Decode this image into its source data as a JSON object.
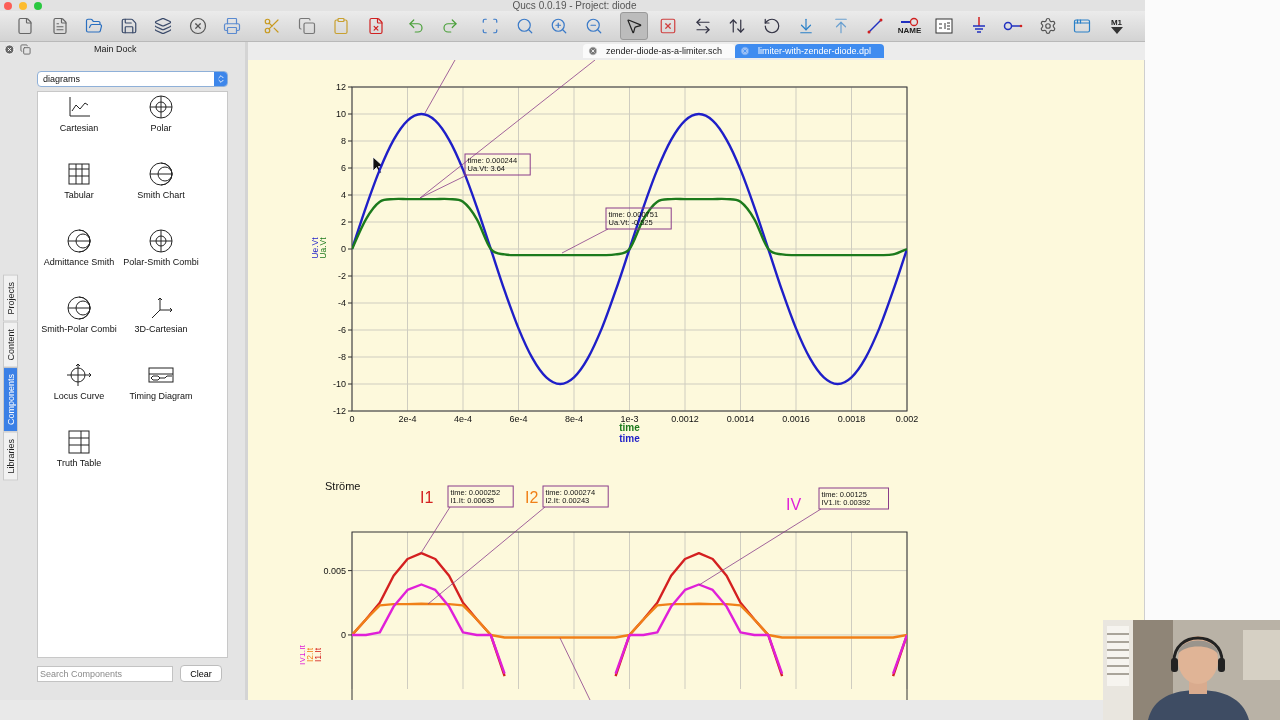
{
  "window": {
    "title": "Qucs 0.0.19 - Project: diode"
  },
  "toolbar_groups": [
    {
      "items": [
        {
          "kind": "new",
          "selected": false
        },
        {
          "kind": "open-text",
          "selected": false
        },
        {
          "kind": "open",
          "selected": false
        },
        {
          "kind": "save",
          "selected": false
        },
        {
          "kind": "save-all",
          "selected": false
        },
        {
          "kind": "close",
          "selected": false
        },
        {
          "kind": "print",
          "selected": false
        }
      ]
    },
    {
      "items": [
        {
          "kind": "cut",
          "selected": false
        },
        {
          "kind": "copy",
          "selected": false
        },
        {
          "kind": "paste",
          "selected": false
        },
        {
          "kind": "delete",
          "selected": false
        }
      ]
    },
    {
      "items": [
        {
          "kind": "undo",
          "selected": false
        },
        {
          "kind": "redo",
          "selected": false
        }
      ]
    },
    {
      "items": [
        {
          "kind": "zoom-fit",
          "selected": false
        },
        {
          "kind": "zoom-one",
          "selected": false
        },
        {
          "kind": "zoom-in",
          "selected": false
        },
        {
          "kind": "zoom-out",
          "selected": false
        }
      ]
    },
    {
      "items": [
        {
          "kind": "select",
          "selected": true
        },
        {
          "kind": "deactivate",
          "selected": false
        },
        {
          "kind": "mirror-x",
          "selected": false
        },
        {
          "kind": "mirror-y",
          "selected": false
        },
        {
          "kind": "rotate",
          "selected": false
        },
        {
          "kind": "move-down",
          "selected": false
        },
        {
          "kind": "move-up",
          "selected": false
        },
        {
          "kind": "wire",
          "selected": false
        },
        {
          "kind": "label",
          "text": "NAME",
          "selected": false
        },
        {
          "kind": "equation",
          "selected": false
        },
        {
          "kind": "ground",
          "selected": false
        },
        {
          "kind": "port",
          "selected": false
        },
        {
          "kind": "simulate",
          "selected": false
        },
        {
          "kind": "dataset",
          "selected": false
        },
        {
          "kind": "marker",
          "text": "M1",
          "selected": false
        }
      ]
    }
  ],
  "dock": {
    "title": "Main Dock",
    "side_tabs": [
      {
        "label": "Projects",
        "selected": false
      },
      {
        "label": "Content",
        "selected": false
      },
      {
        "label": "Components",
        "selected": true
      },
      {
        "label": "Libraries",
        "selected": false
      }
    ],
    "category": "diagrams",
    "items": [
      {
        "kind": "cartesian",
        "label": "Cartesian"
      },
      {
        "kind": "polar",
        "label": "Polar"
      },
      {
        "kind": "tabular",
        "label": "Tabular"
      },
      {
        "kind": "smith",
        "label": "Smith Chart"
      },
      {
        "kind": "smith",
        "label": "Admittance Smith"
      },
      {
        "kind": "polar",
        "label": "Polar-Smith Combi"
      },
      {
        "kind": "smith",
        "label": "Smith-Polar Combi"
      },
      {
        "kind": "cartesian3d",
        "label": "3D-Cartesian"
      },
      {
        "kind": "locus",
        "label": "Locus Curve"
      },
      {
        "kind": "timing",
        "label": "Timing Diagram"
      },
      {
        "kind": "truth",
        "label": "Truth Table"
      }
    ],
    "search": {
      "placeholder": "Search Components"
    },
    "clear_button": "Clear"
  },
  "doc_tabs": [
    {
      "label": "zender-diode-as-a-limiter.sch",
      "selected": false
    },
    {
      "label": "limiter-with-zender-diode.dpl",
      "selected": true
    }
  ],
  "diagrams": [
    {
      "x_axis_labels": [
        {
          "text": "time",
          "color": "#1c7a1c"
        },
        {
          "text": "time",
          "color": "#1f1fc8"
        }
      ],
      "chart_data": {
        "type": "line",
        "grid": true,
        "xlim": [
          0,
          0.002
        ],
        "ylim": [
          -12,
          12
        ],
        "x": [
          0,
          5e-05,
          0.0001,
          0.00015,
          0.0002,
          0.00025,
          0.0003,
          0.00035,
          0.0004,
          0.00045,
          0.0005,
          0.00055,
          0.0006,
          0.00065,
          0.0007,
          0.00075,
          0.0008,
          0.00085,
          0.0009,
          0.00095,
          0.001,
          0.00105,
          0.0011,
          0.00115,
          0.0012,
          0.00125,
          0.0013,
          0.00135,
          0.0014,
          0.00145,
          0.0015,
          0.00155,
          0.0016,
          0.00165,
          0.0017,
          0.00175,
          0.0018,
          0.00185,
          0.0019,
          0.00195,
          0.002
        ],
        "series": [
          {
            "name": "Ue.Vt",
            "color": "#1f1fc8",
            "values": [
              0,
              3.09,
              5.88,
              8.09,
              9.51,
              10,
              9.51,
              8.09,
              5.88,
              3.09,
              0,
              -3.09,
              -5.88,
              -8.09,
              -9.51,
              -10,
              -9.51,
              -8.09,
              -5.88,
              -3.09,
              0,
              3.09,
              5.88,
              8.09,
              9.51,
              10,
              9.51,
              8.09,
              5.88,
              3.09,
              0,
              -3.09,
              -5.88,
              -8.09,
              -9.51,
              -10,
              -9.51,
              -8.09,
              -5.88,
              -3.09,
              0
            ]
          },
          {
            "name": "Ua.Vt",
            "color": "#1c7a1c",
            "values": [
              0,
              2.2,
              3.5,
              3.7,
              3.7,
              3.7,
              3.7,
              3.7,
              3.5,
              2.2,
              0,
              -0.4,
              -0.45,
              -0.45,
              -0.45,
              -0.45,
              -0.45,
              -0.45,
              -0.45,
              -0.4,
              0,
              2.2,
              3.5,
              3.7,
              3.7,
              3.7,
              3.7,
              3.7,
              3.5,
              2.2,
              0,
              -0.4,
              -0.45,
              -0.45,
              -0.45,
              -0.45,
              -0.45,
              -0.45,
              -0.45,
              -0.4,
              0
            ]
          }
        ],
        "xticks": [
          {
            "value": 0,
            "label": "0"
          },
          {
            "value": 0.0002,
            "label": "2e-4"
          },
          {
            "value": 0.0004,
            "label": "4e-4"
          },
          {
            "value": 0.0006,
            "label": "6e-4"
          },
          {
            "value": 0.0008,
            "label": "8e-4"
          },
          {
            "value": 0.001,
            "label": "1e-3"
          },
          {
            "value": 0.0012,
            "label": "0.0012"
          },
          {
            "value": 0.0014,
            "label": "0.0014"
          },
          {
            "value": 0.0016,
            "label": "0.0016"
          },
          {
            "value": 0.0018,
            "label": "0.0018"
          },
          {
            "value": 0.002,
            "label": "0.002"
          }
        ],
        "yticks": [
          -12,
          -10,
          -8,
          -6,
          -4,
          -2,
          0,
          2,
          4,
          6,
          8,
          10,
          12
        ],
        "annotations": [
          {
            "text": "time: 0.000244\nUa.Vt: 3.64"
          },
          {
            "text": "time: 0.000751\nUa.Vt: -0.525"
          }
        ]
      }
    },
    {
      "title": "Ströme",
      "labels": [
        {
          "text": "I1",
          "color": "#d42020"
        },
        {
          "text": "I2",
          "color": "#f08018"
        },
        {
          "text": "IV",
          "color": "#e020d8"
        }
      ],
      "chart_data": {
        "type": "line",
        "grid": true,
        "xlim": [
          0,
          0.002
        ],
        "ylim": [
          -0.0042,
          0.008
        ],
        "x": [
          0,
          5e-05,
          0.0001,
          0.00015,
          0.0002,
          0.00025,
          0.0003,
          0.00035,
          0.0004,
          0.00045,
          0.0005,
          0.00055,
          0.0006,
          0.00065,
          0.0007,
          0.00075,
          0.0008,
          0.00085,
          0.0009,
          0.00095,
          0.001,
          0.00105,
          0.0011,
          0.00115,
          0.0012,
          0.00125,
          0.0013,
          0.00135,
          0.0014,
          0.00145,
          0.0015,
          0.00155,
          0.0016,
          0.00165,
          0.0017,
          0.00175,
          0.0018,
          0.00185,
          0.0019,
          0.00195,
          0.002
        ],
        "series": [
          {
            "name": "I1.It",
            "color": "#d42020",
            "values": [
              0,
              0.0012,
              0.0025,
              0.0046,
              0.0059,
              0.00635,
              0.0059,
              0.0046,
              0.0025,
              0.0012,
              0,
              -0.0032,
              null,
              null,
              null,
              null,
              null,
              null,
              null,
              -0.0032,
              0,
              0.0012,
              0.0025,
              0.0046,
              0.0059,
              0.00635,
              0.0059,
              0.0046,
              0.0025,
              0.0012,
              0,
              -0.0032,
              null,
              null,
              null,
              null,
              null,
              null,
              null,
              -0.0032,
              0
            ]
          },
          {
            "name": "I2.It",
            "color": "#f08018",
            "values": [
              0,
              0.0012,
              0.0023,
              0.0024,
              0.0024,
              0.00243,
              0.0024,
              0.0024,
              0.0023,
              0.0012,
              0,
              -0.0002,
              -0.0002,
              -0.0002,
              -0.0002,
              -0.0002,
              -0.0002,
              -0.0002,
              -0.0002,
              -0.0002,
              0,
              0.0012,
              0.0023,
              0.0024,
              0.0024,
              0.00243,
              0.0024,
              0.0024,
              0.0023,
              0.0012,
              0,
              -0.0002,
              -0.0002,
              -0.0002,
              -0.0002,
              -0.0002,
              -0.0002,
              -0.0002,
              -0.0002,
              -0.0002,
              0
            ]
          },
          {
            "name": "IV1.It",
            "color": "#e020d8",
            "values": [
              0,
              0,
              0.0002,
              0.0022,
              0.0035,
              0.00392,
              0.0035,
              0.0022,
              0.0002,
              0,
              0,
              -0.003,
              null,
              null,
              null,
              null,
              null,
              null,
              null,
              -0.003,
              0,
              0,
              0.0002,
              0.0022,
              0.0035,
              0.00392,
              0.0035,
              0.0022,
              0.0002,
              0,
              0,
              -0.003,
              null,
              null,
              null,
              null,
              null,
              null,
              null,
              -0.003,
              0
            ]
          }
        ],
        "yticks": [
          {
            "value": 0,
            "label": "0"
          },
          {
            "value": 0.005,
            "label": "0.005"
          }
        ],
        "annotations": [
          {
            "text": "time: 0.000252\nI1.It: 0.00635"
          },
          {
            "text": "time: 0.000274\nI2.It: 0.00243"
          },
          {
            "text": "time: 0.00125\nIV1.It: 0.00392"
          }
        ]
      }
    }
  ]
}
